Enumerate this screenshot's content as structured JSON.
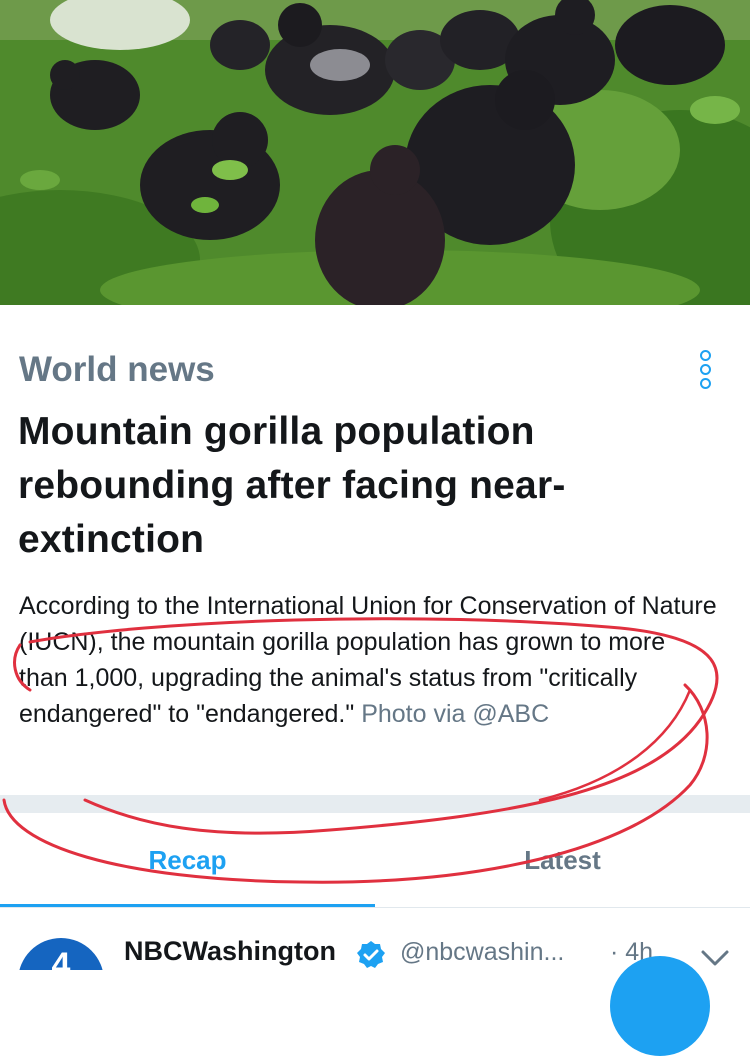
{
  "hero": {
    "alt": "Mountain gorillas in green vegetation"
  },
  "card": {
    "category": "World news",
    "headline": "Mountain gorilla population rebounding after facing near-extinction",
    "summary": "According to the International Union for Conservation of Nature (IUCN), the mountain gorilla population has grown to more than 1,000, upgrading the animal's status from \"critically endangered\" to \"endangered.\"",
    "credit": "Photo via @ABC",
    "menu_icon": "more-vertical-icon"
  },
  "tabs": [
    {
      "label": "Recap",
      "active": true
    },
    {
      "label": "Latest",
      "active": false
    }
  ],
  "tweet": {
    "name": "NBCWashington",
    "verified_icon": "verified-badge-icon",
    "handle": "@nbcwashin...",
    "time": "· 4h",
    "avatar_text": "4",
    "avatar_color": "#1565c0"
  },
  "colors": {
    "accent": "#1da1f2",
    "text": "#14171a",
    "muted": "#657786",
    "annotation": "#e0303f"
  }
}
